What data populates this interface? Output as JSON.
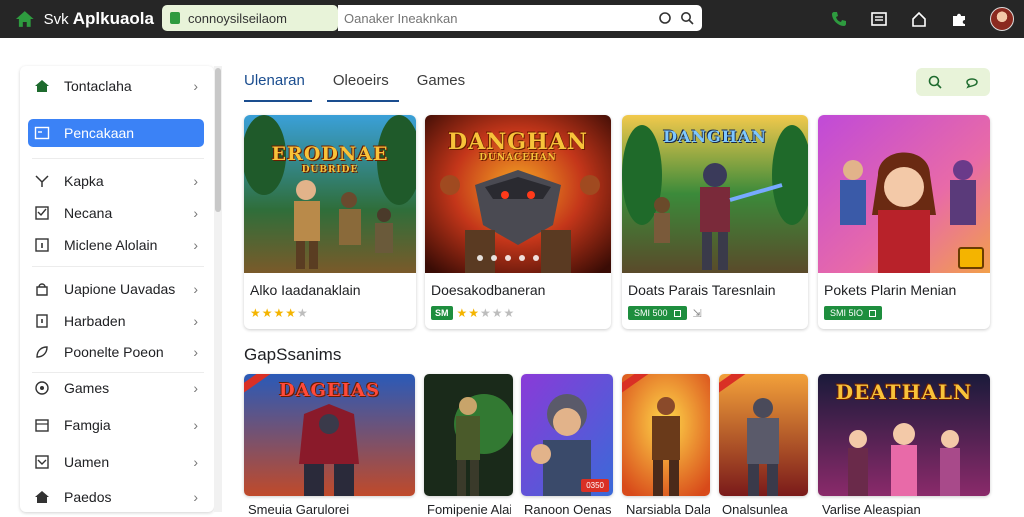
{
  "header": {
    "brand_prefix": "Svk",
    "brand_name": "Aplkuaola",
    "brand_tagline": "",
    "url": "connoysilseilaom",
    "search_placeholder": "Oanaker Ineaknkan",
    "icons": [
      "grid-icon",
      "phone-icon",
      "news-icon",
      "home-icon",
      "puzzle-icon",
      "avatar"
    ]
  },
  "sidebar": {
    "items": [
      {
        "label": "Tontaclaha",
        "icon": "home-icon",
        "chevron": "›"
      },
      {
        "label": "Pencakaan",
        "icon": "calendar-icon",
        "chevron": ""
      },
      {
        "label": "Kapka",
        "icon": "tools-icon",
        "chevron": "›"
      },
      {
        "label": "Necana",
        "icon": "checkbox-icon",
        "chevron": "›"
      },
      {
        "label": "Miclene Alolain",
        "icon": "info-icon",
        "chevron": "›"
      },
      {
        "label": "Uapione Uavadas",
        "icon": "bag-icon",
        "chevron": "›"
      },
      {
        "label": "Harbaden",
        "icon": "tablet-icon",
        "chevron": "›"
      },
      {
        "label": "Poonelte Poeon",
        "icon": "leaf-icon",
        "chevron": "›"
      },
      {
        "label": "Games",
        "icon": "globe-icon",
        "chevron": "›"
      },
      {
        "label": "Famgia",
        "icon": "table-icon",
        "chevron": "›"
      },
      {
        "label": "Uamen",
        "icon": "checkbox-icon",
        "chevron": "›"
      },
      {
        "label": "Paedos",
        "icon": "home-icon",
        "chevron": "›"
      }
    ]
  },
  "tabs": [
    {
      "label": "Ulenaran",
      "active": true
    },
    {
      "label": "Oleoeirs",
      "active": false
    },
    {
      "label": "Games",
      "active": false
    }
  ],
  "featured": [
    {
      "art_title": "ERODNAE",
      "art_sub": "DUBRIDE",
      "title": "Alko Iaadanaklain",
      "meta_type": "stars",
      "rating": 4,
      "rating_max": 5
    },
    {
      "art_title": "DANGHAN",
      "art_sub": "DUNACEHAN",
      "title": "Doesakodbaneran",
      "meta_type": "badge-stars",
      "badge": "SM",
      "rating": 2,
      "rating_max": 5
    },
    {
      "art_title": "DANGHAN",
      "art_sub": "",
      "title": "Doats Parais Taresnlain",
      "meta_type": "pill",
      "pill": "SMI 500",
      "extra": "⇲"
    },
    {
      "art_title": "",
      "art_sub": "",
      "title": "Pokets Plarin Menian",
      "meta_type": "pill",
      "pill": "SMI 5IO"
    }
  ],
  "section_title": "GapSsanims",
  "tiles": [
    {
      "art_title": "DAGEIAS",
      "label": "Smeuia Garulorei",
      "tag": ""
    },
    {
      "art_title": "",
      "label": "Fomipenie Alain",
      "tag": ""
    },
    {
      "art_title": "",
      "label": "Ranoon Oenasn",
      "tag": "0350"
    },
    {
      "art_title": "",
      "label": "Narsiabla Dalaneia",
      "tag": ""
    },
    {
      "art_title": "",
      "label": "Onalsunlea",
      "tag": ""
    },
    {
      "art_title": "DEATHALN",
      "label": "Varlise Aleaspian",
      "tag": ""
    }
  ],
  "colors": {
    "topbar": "#262626",
    "accent": "#3b82f6",
    "tab_active": "#1a4d8f",
    "green_badge": "#1e8e3e",
    "star": "#f4b400"
  }
}
